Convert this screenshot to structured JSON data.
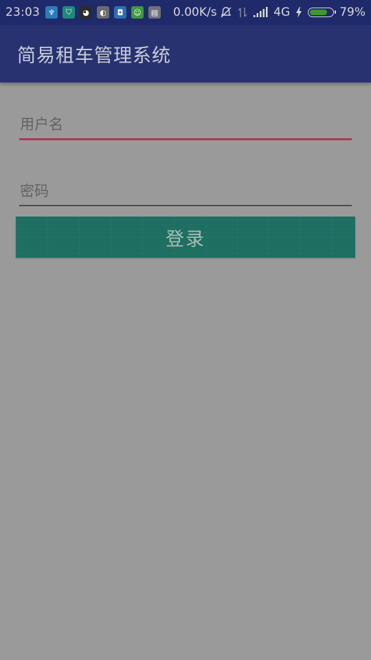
{
  "status_bar": {
    "time": "23:03",
    "net_speed": "0.00K/s",
    "network_type": "4G",
    "battery_text": "79%",
    "battery_level": 0.79,
    "app_icons": [
      {
        "name": "usb-icon",
        "glyph": "♆",
        "color": "#2a7db8"
      },
      {
        "name": "shield-app-icon",
        "glyph": "⛉",
        "color": "#1e8a7a"
      },
      {
        "name": "qq-penguin-icon",
        "glyph": "◕",
        "color": "#2b2b2b"
      },
      {
        "name": "cat-avatar-app-icon",
        "glyph": "◐",
        "color": "#6c6c6c"
      },
      {
        "name": "cleanup-app-icon",
        "glyph": "◘",
        "color": "#2c6fb0"
      },
      {
        "name": "android-app-icon",
        "glyph": "☺",
        "color": "#3d9a3a"
      },
      {
        "name": "message-app-icon",
        "glyph": "▤",
        "color": "#6f7378"
      }
    ],
    "right_icons": [
      "mute-bell-icon",
      "data-transfer-icon",
      "signal-bars-icon",
      "charging-bolt-icon",
      "battery-icon"
    ]
  },
  "app_bar": {
    "title": "简易租车管理系统"
  },
  "form": {
    "username_placeholder": "用户名",
    "password_placeholder": "密码",
    "login_label": "登录"
  },
  "colors": {
    "status_bar_bg": "#1f2a6b",
    "app_bar_bg": "#283270",
    "focus_underline": "#b0384f",
    "button_bg": "#1e6e62",
    "page_bg": "#9a9a9a"
  }
}
